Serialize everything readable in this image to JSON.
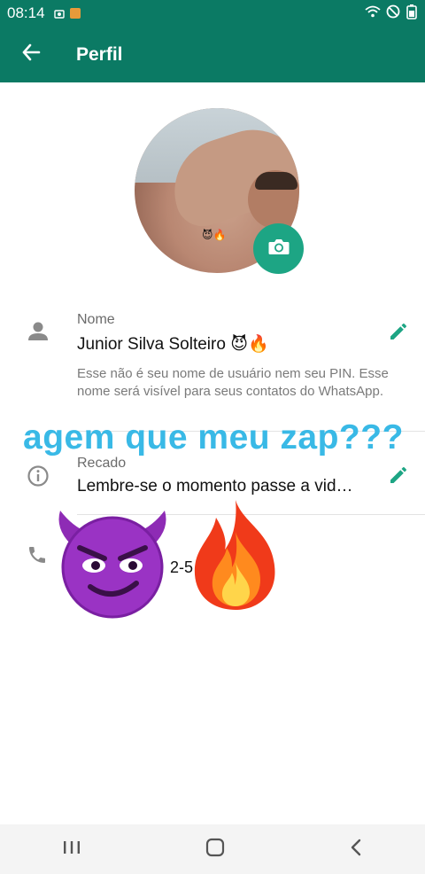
{
  "status_bar": {
    "time": "08:14"
  },
  "app_bar": {
    "title": "Perfil",
    "back_icon": "arrow-left-icon"
  },
  "profile": {
    "name_label": "Nome",
    "name_value": "Junior Silva Solteiro 😈🔥",
    "name_hint": "Esse não é seu nome de usuário nem seu PIN. Esse nome será visível para seus contatos do WhatsApp.",
    "about_label": "Recado",
    "about_value": "Lembre-se o momento passe a vid…",
    "phone_partial": "2-5",
    "avatar_emoji": "😈🔥"
  },
  "overlay": {
    "caption": "agem que meu zap???"
  },
  "colors": {
    "primary": "#0b7a64",
    "accent": "#1da584",
    "caption": "#39b9e6"
  }
}
